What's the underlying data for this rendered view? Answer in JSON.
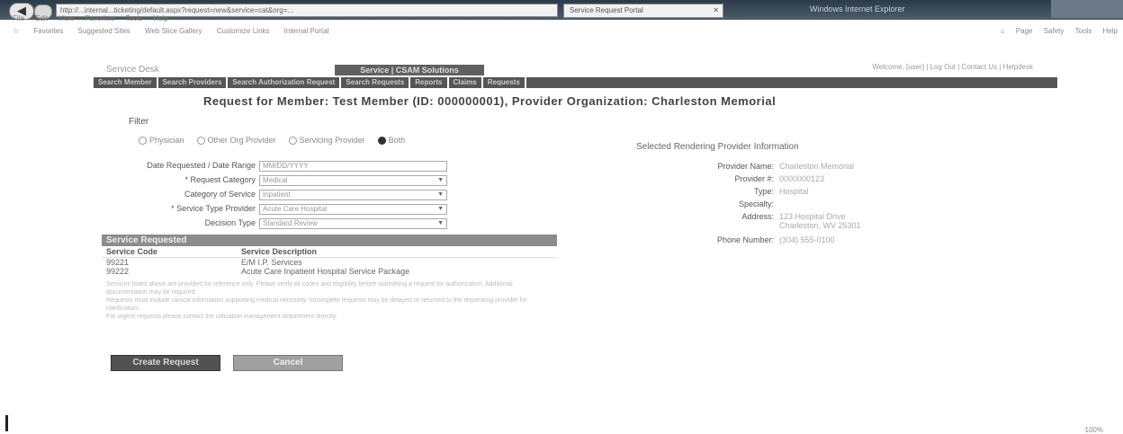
{
  "browser": {
    "url": "http://...internal...ticketing/default.aspx?request=new&service=cat&org=...",
    "tab_title": "Service Request Portal",
    "window_title": "Windows Internet Explorer",
    "menu": [
      "File",
      "Edit",
      "View",
      "Favorites",
      "Tools",
      "Help"
    ],
    "favorites_left": [
      "Favorites",
      "Suggested Sites",
      "Web Slice Gallery",
      "Customize Links",
      "Internal Portal"
    ],
    "favorites_right": [
      "Page",
      "Safety",
      "Tools",
      "Help"
    ]
  },
  "app": {
    "logo": "Service Desk",
    "center_label": "Service | CSAM Solutions",
    "user_line": "Welcome, [user] | Log Out | Contact Us | Helpdesk",
    "nav": [
      "Search Member",
      "Search Providers",
      "Search Authorization Request",
      "Search Requests",
      "Reports",
      "Claims",
      "Requests"
    ]
  },
  "page": {
    "title": "Request for Member: Test Member (ID: 000000001), Provider Organization: Charleston Memorial",
    "filter_label": "Filter",
    "radios": [
      {
        "label": "Physician",
        "selected": false
      },
      {
        "label": "Other Org Provider",
        "selected": false
      },
      {
        "label": "Servicing Provider",
        "selected": false
      },
      {
        "label": "Both",
        "selected": true
      }
    ],
    "form": [
      {
        "label": "Date Requested / Date Range",
        "value": "MM/DD/YYYY",
        "is_select": false
      },
      {
        "label": "* Request Category",
        "value": "Medical",
        "is_select": true
      },
      {
        "label": "Category of Service",
        "value": "Inpatient",
        "is_select": true
      },
      {
        "label": "* Service Type Provider",
        "value": "Acute Care Hospital",
        "is_select": true
      },
      {
        "label": "Decision Type",
        "value": "Standard Review",
        "is_select": true
      }
    ],
    "service_panel": {
      "header": "Service Requested",
      "columns": [
        "Service Code",
        "Service Description"
      ],
      "rows": [
        {
          "code": "99221",
          "desc": "E/M I.P. Services"
        },
        {
          "code": "99222",
          "desc": "Acute Care Inpatient Hospital Service Package"
        }
      ],
      "notes": [
        "Services listed above are provided for reference only. Please verify all codes and eligibility before submitting a request for authorization. Additional documentation may be required.",
        "Requests must include clinical information supporting medical necessity. Incomplete requests may be delayed or returned to the requesting provider for clarification.",
        "For urgent requests please contact the utilization management department directly."
      ]
    },
    "summary": {
      "title": "Selected Rendering Provider Information",
      "fields": [
        {
          "key": "Provider Name:",
          "value": "Charleston Memorial"
        },
        {
          "key": "Provider #:",
          "value": "0000000123"
        },
        {
          "key": "Type:",
          "value": "Hospital"
        },
        {
          "key": "Specialty:",
          "value": ""
        },
        {
          "key": "Address:",
          "value": "123 Hospital Drive Charleston, WV 25301"
        },
        {
          "key": "Phone Number:",
          "value": "(304) 555-0100"
        }
      ]
    },
    "buttons": {
      "create": "Create Request",
      "cancel": "Cancel"
    }
  },
  "status": {
    "zoom": "100%"
  }
}
